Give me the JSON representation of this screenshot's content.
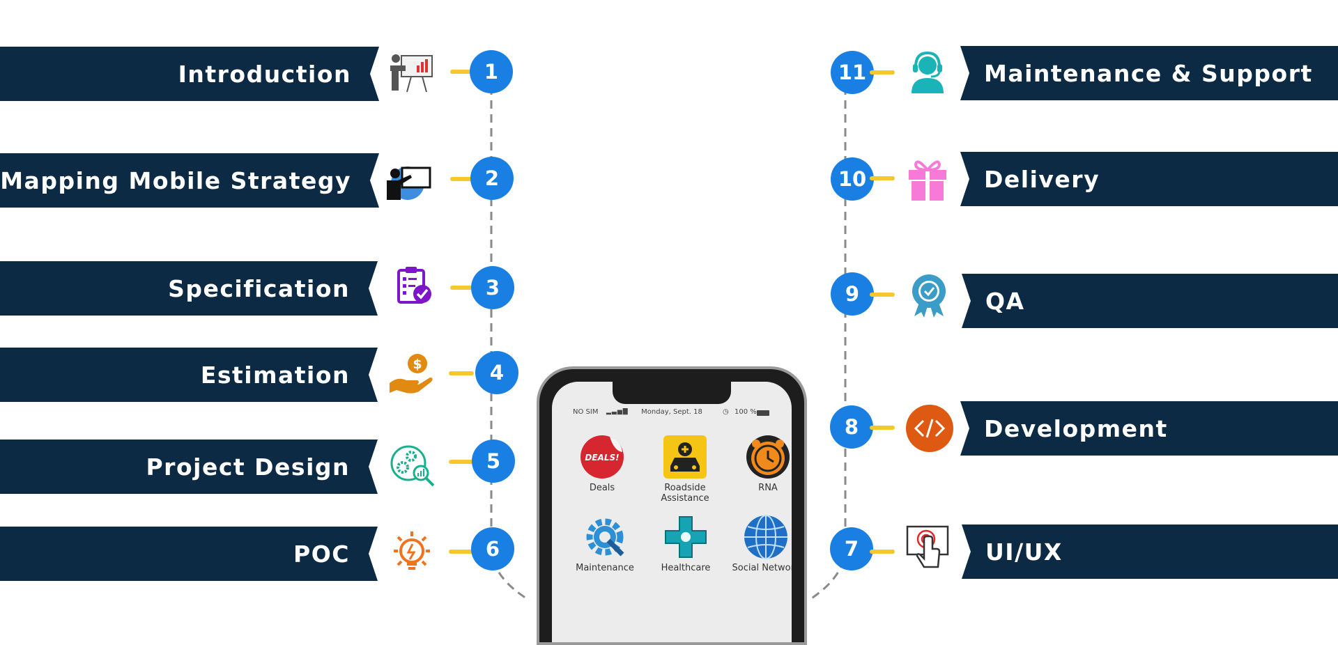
{
  "steps_left": [
    {
      "num": "1",
      "label": "Introduction",
      "icon": "presentation-icon"
    },
    {
      "num": "2",
      "label": "Mapping Mobile Strategy",
      "icon": "presenter-board-icon"
    },
    {
      "num": "3",
      "label": "Specification",
      "icon": "clipboard-check-icon"
    },
    {
      "num": "4",
      "label": "Estimation",
      "icon": "dollar-hand-icon"
    },
    {
      "num": "5",
      "label": "Project Design",
      "icon": "gears-search-icon"
    },
    {
      "num": "6",
      "label": "POC",
      "icon": "lightbulb-icon"
    }
  ],
  "steps_right": [
    {
      "num": "11",
      "label": "Maintenance & Support",
      "icon": "headset-support-icon"
    },
    {
      "num": "10",
      "label": "Delivery",
      "icon": "gift-icon"
    },
    {
      "num": "9",
      "label": "QA",
      "icon": "badge-check-icon"
    },
    {
      "num": "8",
      "label": "Development",
      "icon": "code-icon"
    },
    {
      "num": "7",
      "label": "UI/UX",
      "icon": "touch-screen-icon"
    }
  ],
  "phone": {
    "status": {
      "carrier": "NO SIM",
      "date": "Monday, Sept. 18",
      "battery": "100 %"
    },
    "apps": [
      {
        "label": "Deals",
        "icon": "deals-icon",
        "badge_text": "DEALS!"
      },
      {
        "label": "Roadside Assistance",
        "icon": "roadside-icon"
      },
      {
        "label": "RNA",
        "icon": "alarm-clock-icon"
      },
      {
        "label": "Maintenance",
        "icon": "gear-wrench-icon"
      },
      {
        "label": "Healthcare",
        "icon": "healthcare-icon"
      },
      {
        "label": "Social Network",
        "icon": "globe-icon"
      }
    ]
  },
  "colors": {
    "banner": "#0c2a44",
    "circle": "#1a7fe3",
    "connector": "#f7c82e",
    "dashed_line": "#8a8a8a"
  }
}
